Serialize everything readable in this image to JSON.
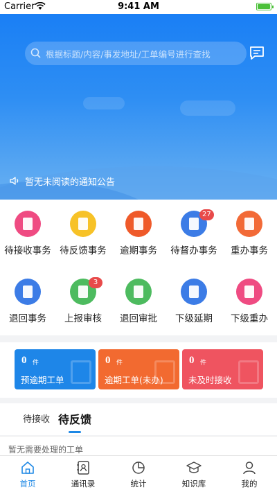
{
  "status_bar": {
    "carrier": "Carrier",
    "time": "9:41 AM"
  },
  "header": {
    "search_placeholder": "根据标题/内容/事发地址/工单编号进行查找",
    "notice": "暂无未阅读的通知公告"
  },
  "grid": {
    "items": [
      {
        "label": "待接收事务",
        "icon": "inbox-icon",
        "color": "#ef4b82",
        "badge": ""
      },
      {
        "label": "待反馈事务",
        "icon": "feedback-icon",
        "color": "#f7c227",
        "badge": ""
      },
      {
        "label": "逾期事务",
        "icon": "alarm-icon",
        "color": "#ef5a2a",
        "badge": ""
      },
      {
        "label": "待督办事务",
        "icon": "eye-icon",
        "color": "#3c7ce6",
        "badge": "27"
      },
      {
        "label": "重办事务",
        "icon": "redo-doc-icon",
        "color": "#f26a37",
        "badge": ""
      },
      {
        "label": "退回事务",
        "icon": "return-doc-icon",
        "color": "#3c7ce6",
        "badge": ""
      },
      {
        "label": "上报审核",
        "icon": "stamp-icon",
        "color": "#4dbb5f",
        "badge": "3"
      },
      {
        "label": "退回审批",
        "icon": "approval-doc-icon",
        "color": "#4dbb5f",
        "badge": ""
      },
      {
        "label": "下级延期",
        "icon": "calendar-doc-icon",
        "color": "#3c7ce6",
        "badge": ""
      },
      {
        "label": "下级重办",
        "icon": "folder-icon",
        "color": "#ef4b82",
        "badge": ""
      }
    ]
  },
  "cards": [
    {
      "count": "0",
      "unit": "件",
      "title": "预逾期工单",
      "color": "#1e86e8"
    },
    {
      "count": "0",
      "unit": "件",
      "title": "逾期工单(未办)",
      "color": "#f26a30"
    },
    {
      "count": "0",
      "unit": "件",
      "title": "未及时接收",
      "color": "#ef5460"
    }
  ],
  "tabs": {
    "items": [
      "待接收",
      "待反馈"
    ],
    "active_index": 1
  },
  "empty_text": "暂无需要处理的工单",
  "nav": {
    "items": [
      {
        "label": "首页",
        "icon": "home-icon",
        "active": true
      },
      {
        "label": "通讯录",
        "icon": "contacts-icon",
        "active": false
      },
      {
        "label": "统计",
        "icon": "pie-chart-icon",
        "active": false
      },
      {
        "label": "知识库",
        "icon": "graduation-cap-icon",
        "active": false
      },
      {
        "label": "我的",
        "icon": "user-icon",
        "active": false
      }
    ]
  }
}
